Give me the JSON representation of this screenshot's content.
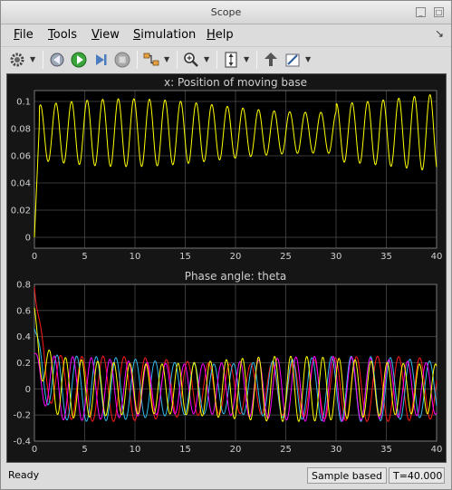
{
  "window": {
    "title": "Scope"
  },
  "menu": [
    {
      "label": "File",
      "underline": "F",
      "rest": "ile"
    },
    {
      "label": "Tools",
      "underline": "T",
      "rest": "ools"
    },
    {
      "label": "View",
      "underline": "V",
      "rest": "iew"
    },
    {
      "label": "Simulation",
      "underline": "S",
      "rest": "imulation"
    },
    {
      "label": "Help",
      "underline": "H",
      "rest": "elp"
    }
  ],
  "toolbar": {
    "icons": [
      "gear-icon",
      "step-back-icon",
      "run-icon",
      "step-forward-icon",
      "stop-icon",
      "signal-selector-icon",
      "zoom-icon",
      "autoscale-icon",
      "highlight-block-icon",
      "style-icon"
    ]
  },
  "status": {
    "state": "Ready",
    "mode": "Sample based",
    "time": "T=40.000"
  },
  "colors": {
    "plot_bg": "#000000",
    "grid": "#4a4a4a",
    "axis_text": "#d0d0d0",
    "yellow": "#ffff00",
    "red": "#ff1a1a",
    "cyan": "#33bbee",
    "magenta": "#ff00ff"
  },
  "chart_data": [
    {
      "type": "line",
      "title": "x: Position of moving base",
      "xlim": [
        0,
        40
      ],
      "ylim": [
        -0.008,
        0.108
      ],
      "xticks": [
        0,
        5,
        10,
        15,
        20,
        25,
        30,
        35,
        40
      ],
      "yticks": [
        0,
        0.02,
        0.04,
        0.06,
        0.08,
        0.1
      ],
      "ytick_labels": [
        "0",
        "0.02",
        "0.04",
        "0.06",
        "0.08",
        "0.1"
      ],
      "grid": true,
      "series": [
        {
          "color": "yellow",
          "kind": "base_position"
        }
      ]
    },
    {
      "type": "line",
      "title": "Phase angle: theta",
      "xlim": [
        0,
        40
      ],
      "ylim": [
        -0.4,
        0.8
      ],
      "xticks": [
        0,
        5,
        10,
        15,
        20,
        25,
        30,
        35,
        40
      ],
      "yticks": [
        -0.4,
        -0.2,
        0,
        0.2,
        0.4,
        0.6,
        0.8
      ],
      "ytick_labels": [
        "-0.4",
        "-0.2",
        "0",
        "0.2",
        "0.4",
        "0.6",
        "0.8"
      ],
      "grid": true,
      "series": [
        {
          "color": "red",
          "kind": "theta",
          "start": 0.78,
          "period": 2.1,
          "phase": 0.0
        },
        {
          "color": "cyan",
          "kind": "theta",
          "start": 0.45,
          "period": 1.95,
          "phase": 0.6
        },
        {
          "color": "magenta",
          "kind": "theta",
          "start": 0.25,
          "period": 1.85,
          "phase": 1.2
        },
        {
          "color": "yellow",
          "kind": "theta",
          "start": 0.6,
          "period": 1.6,
          "phase": 2.0
        }
      ]
    }
  ]
}
